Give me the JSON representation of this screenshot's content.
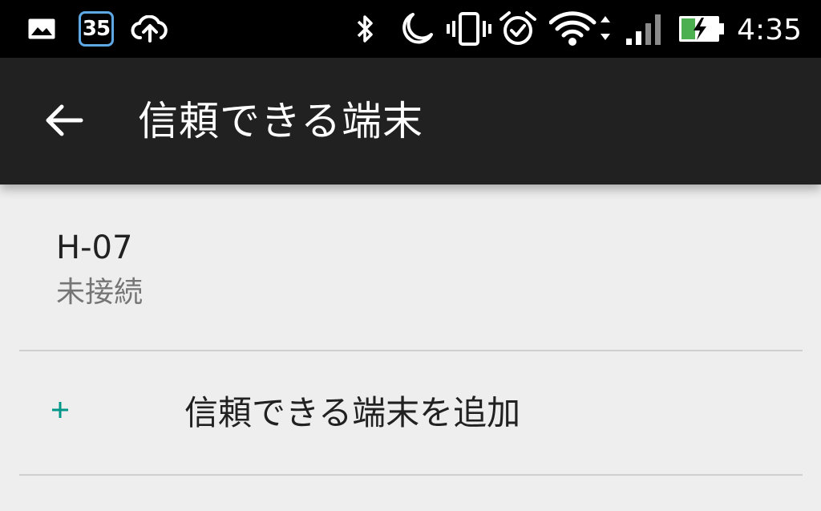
{
  "status_bar": {
    "icons_left": [
      "image-icon",
      "calendar-35-icon",
      "cloud-upload-icon"
    ],
    "notification_badge": "35",
    "icons_right": [
      "bluetooth-icon",
      "moon-icon",
      "vibrate-icon",
      "alarm-icon",
      "wifi-icon",
      "signal-icon",
      "battery-charging-icon"
    ],
    "time": "4:35",
    "colors": {
      "background": "#000000",
      "icon": "#ffffff",
      "badge_border": "#5fa8e6",
      "battery_charge": "#4caf50"
    }
  },
  "app_bar": {
    "back_icon": "arrow-back-icon",
    "title": "信頼できる端末",
    "background": "#212121"
  },
  "devices": [
    {
      "name": "H-07",
      "status": "未接続"
    }
  ],
  "add_device": {
    "icon": "plus-icon",
    "label": "信頼できる端末を追加",
    "icon_color": "#009688"
  }
}
